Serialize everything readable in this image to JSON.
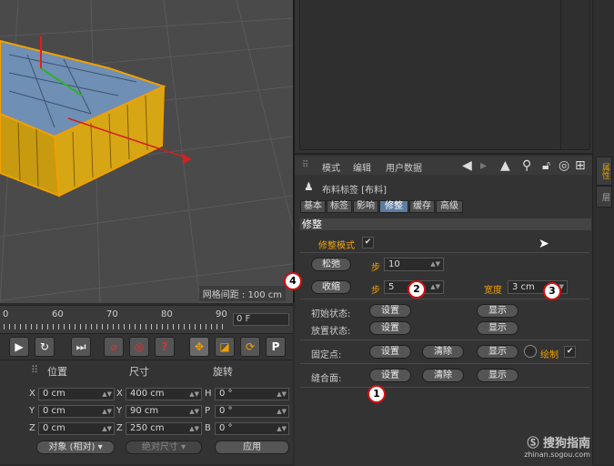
{
  "viewport": {
    "grid_spacing_label": "网格间距 : 100 cm"
  },
  "timeline": {
    "ticks": [
      "0",
      "60",
      "70",
      "80",
      "90"
    ],
    "frame": "0 F"
  },
  "coordinates": {
    "headers": {
      "position": "位置",
      "size": "尺寸",
      "rotation": "旋转"
    },
    "rows": [
      {
        "pos_axis": "X",
        "pos": "0 cm",
        "size_axis": "X",
        "size": "400 cm",
        "rot_axis": "H",
        "rot": "0 °"
      },
      {
        "pos_axis": "Y",
        "pos": "0 cm",
        "size_axis": "Y",
        "size": "90 cm",
        "rot_axis": "P",
        "rot": "0 °"
      },
      {
        "pos_axis": "Z",
        "pos": "0 cm",
        "size_axis": "Z",
        "size": "250 cm",
        "rot_axis": "B",
        "rot": "0 °"
      }
    ],
    "mode_dropdown": "对象 (相对)",
    "size_dropdown": "绝对尺寸",
    "apply_button": "应用"
  },
  "attribute_manager": {
    "menu": [
      "模式",
      "编辑",
      "用户数据"
    ],
    "tag_title": "布料标签 [布料]",
    "tabs": [
      "基本",
      "标签",
      "影响",
      "修整",
      "缓存",
      "高级"
    ],
    "active_tab": "修整",
    "section": "修整",
    "dress_mode_label": "修整模式",
    "relax_button": "松弛",
    "step_label": "步",
    "relax_steps": "10",
    "shrink_button": "收缩",
    "shrink_steps": "5",
    "width_label": "宽度",
    "width_value": "3 cm",
    "init_state_label": "初始状态:",
    "dress_state_label": "放置状态:",
    "fix_points_label": "固定点:",
    "seam_label": "缝合面:",
    "set_label": "设置",
    "clear_label": "清除",
    "show_label": "显示",
    "draw_label": "绘制"
  },
  "side_tabs": [
    "属性",
    "层"
  ],
  "annotations": [
    "1",
    "2",
    "3",
    "4"
  ],
  "watermark": {
    "brand": "搜狗指南",
    "url": "zhinan.sogou.com"
  },
  "colors": {
    "accent_orange": "#f2a000",
    "active_tab": "#5c7ca0",
    "annotation_red": "#d01010"
  }
}
